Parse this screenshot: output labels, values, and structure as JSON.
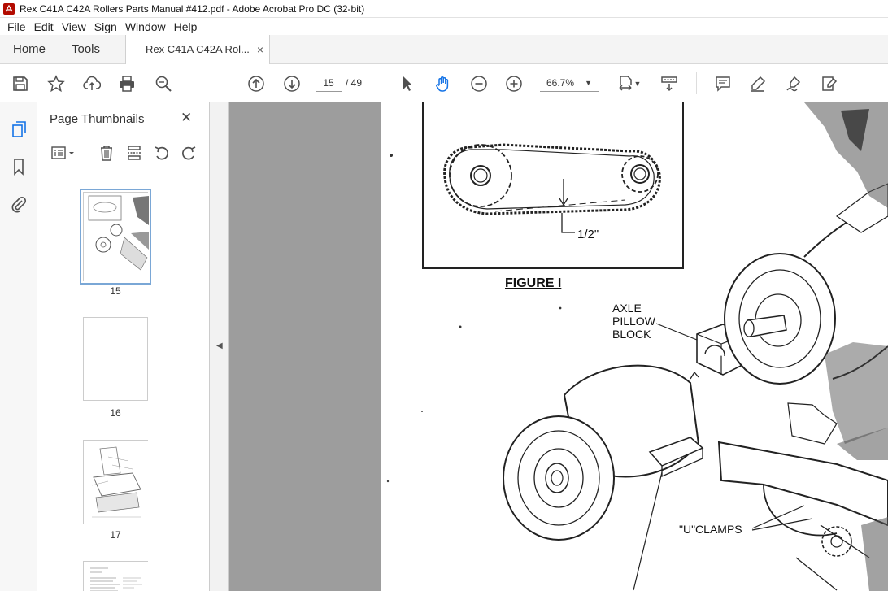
{
  "window": {
    "title": "Rex C41A C42A Rollers Parts Manual #412.pdf - Adobe Acrobat Pro DC (32-bit)"
  },
  "menu": [
    "File",
    "Edit",
    "View",
    "Sign",
    "Window",
    "Help"
  ],
  "tabs": {
    "home": "Home",
    "tools": "Tools",
    "document": "Rex C41A C42A Rol...",
    "close": "×"
  },
  "toolbar": {
    "current_page": "15",
    "page_total": "/ 49",
    "zoom": "66.7%"
  },
  "thumbnails_panel": {
    "title": "Page Thumbnails",
    "close": "✕",
    "pages": [
      {
        "label": "15",
        "selected": true
      },
      {
        "label": "16",
        "selected": false
      },
      {
        "label": "17",
        "selected": false
      }
    ]
  },
  "document": {
    "figure_caption": "FIGURE I",
    "dimension_label": "1/2\"",
    "callout_pillow_block": [
      "AXLE",
      "PILLOW",
      "BLOCK"
    ],
    "callout_clamps": "\"U\"CLAMPS"
  },
  "colors": {
    "acrobat_red": "#b30b00",
    "selection_blue": "#7aa7d6",
    "icon_gray": "#505050",
    "hand_active_blue": "#1473e6"
  }
}
